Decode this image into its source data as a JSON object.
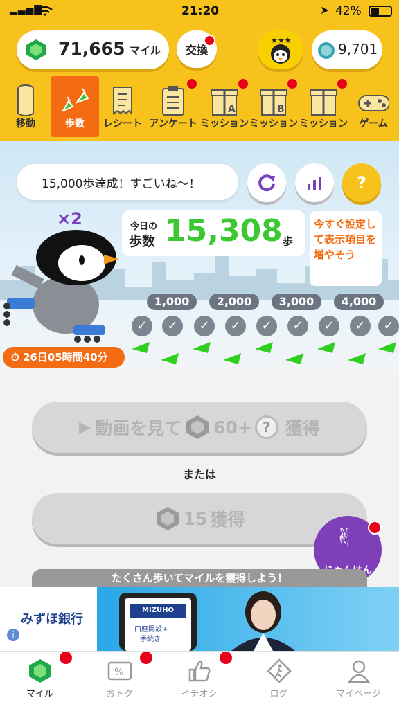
{
  "status": {
    "time": "21:20",
    "battery": "42%"
  },
  "header": {
    "miles": "71,665",
    "miles_unit": "マイル",
    "exchange_label": "交換",
    "coin_value": "9,701"
  },
  "tabs": [
    {
      "label": "移動"
    },
    {
      "label": "歩数"
    },
    {
      "label": "レシート"
    },
    {
      "label": "アンケート"
    },
    {
      "label": "ミッション"
    },
    {
      "label": "ミッション"
    },
    {
      "label": "ミッション"
    },
    {
      "label": "ゲーム"
    }
  ],
  "hero": {
    "bubble": "15,000歩達成！すごいね〜！",
    "multiplier": "×2",
    "today_label_1": "今日の",
    "today_label_2": "歩数",
    "steps": "15,308",
    "steps_unit": "歩",
    "tip": "今すぐ設定して表示項目を増やそう",
    "milestones": [
      "1,000",
      "2,000",
      "3,000",
      "4,000"
    ],
    "timer": "26日05時間40分",
    "help": "?"
  },
  "actions": {
    "video_btn_1": "動画を見て",
    "video_btn_2": "60+",
    "video_btn_3": "獲得",
    "or": "または",
    "earn_value": "15",
    "earn_label": "獲得",
    "janken": "じゃんけん",
    "tip_bar": "たくさん歩いてマイルを獲得しよう！"
  },
  "ad": {
    "bank": "みずほ銀行",
    "card_brand": "MIZUHO",
    "card_line1": "口座開設+",
    "card_line2": "手続き"
  },
  "nav": [
    {
      "label": "マイル"
    },
    {
      "label": "おトク"
    },
    {
      "label": "イチオシ"
    },
    {
      "label": "ログ"
    },
    {
      "label": "マイページ"
    }
  ],
  "colors": {
    "brand_yellow": "#f8c21c",
    "accent_orange": "#f36c14",
    "steps_green": "#3cc832",
    "badge_red": "#e8001a"
  }
}
